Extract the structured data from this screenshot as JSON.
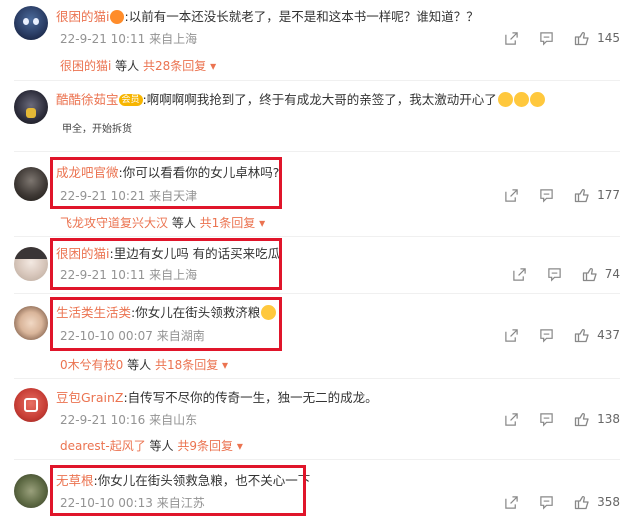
{
  "comments": [
    {
      "user": "很困的猫i",
      "text": ":以前有一本还没长就老了，是不是和这本书一样呢？谁知道？？",
      "time": "22-9-21 10:11",
      "location": "来自上海",
      "likes": "145",
      "reply": {
        "name": "很困的猫i",
        "suffix": " 等人",
        "more": "共28条回复"
      }
    },
    {
      "user": "酷酷徐茹宝",
      "badge": "会员",
      "text": ":啊啊啊啊我抢到了，终于有成龙大哥的亲签了，我太激动开心了",
      "image_text": "甲全，开始拆货"
    },
    {
      "user": "成龙吧官微",
      "text": ":你可以看看你的女儿卓林吗?",
      "time": "22-9-21 10:21",
      "location": "来自天津",
      "likes": "177",
      "reply": {
        "name": "飞龙攻守道复兴大汉",
        "suffix": " 等人",
        "more": "共1条回复"
      }
    },
    {
      "user": "很困的猫i",
      "text": ":里边有女儿吗 有的话买来吃瓜",
      "time": "22-9-21 10:11",
      "location": "来自上海",
      "likes": "74"
    },
    {
      "user": "生活类生活类",
      "text": ":你女儿在街头领救济粮",
      "time": "22-10-10 00:07",
      "location": "来自湖南",
      "likes": "437",
      "reply": {
        "name": "0木兮有枝0",
        "suffix": " 等人",
        "more": "共18条回复"
      }
    },
    {
      "user": "豆包GrainZ",
      "text": ":自传写不尽你的传奇一生，独一无二的成龙。",
      "time": "22-9-21 10:16",
      "location": "来自山东",
      "likes": "138",
      "reply": {
        "name": "dearest-起风了",
        "suffix": " 等人",
        "more": "共9条回复"
      }
    },
    {
      "user": "无草根",
      "text": ":你女儿在街头领救急粮，也不关心一下",
      "time": "22-10-10 00:13",
      "location": "来自江苏",
      "likes": "358"
    }
  ],
  "colors": {
    "username": "#eb7350",
    "highlight": "#e0152a",
    "meta": "#939393"
  },
  "icons": [
    "share-icon",
    "comment-icon",
    "like-icon",
    "laugh-cry-emoji",
    "smirk-emoji",
    "angry-emoji"
  ]
}
